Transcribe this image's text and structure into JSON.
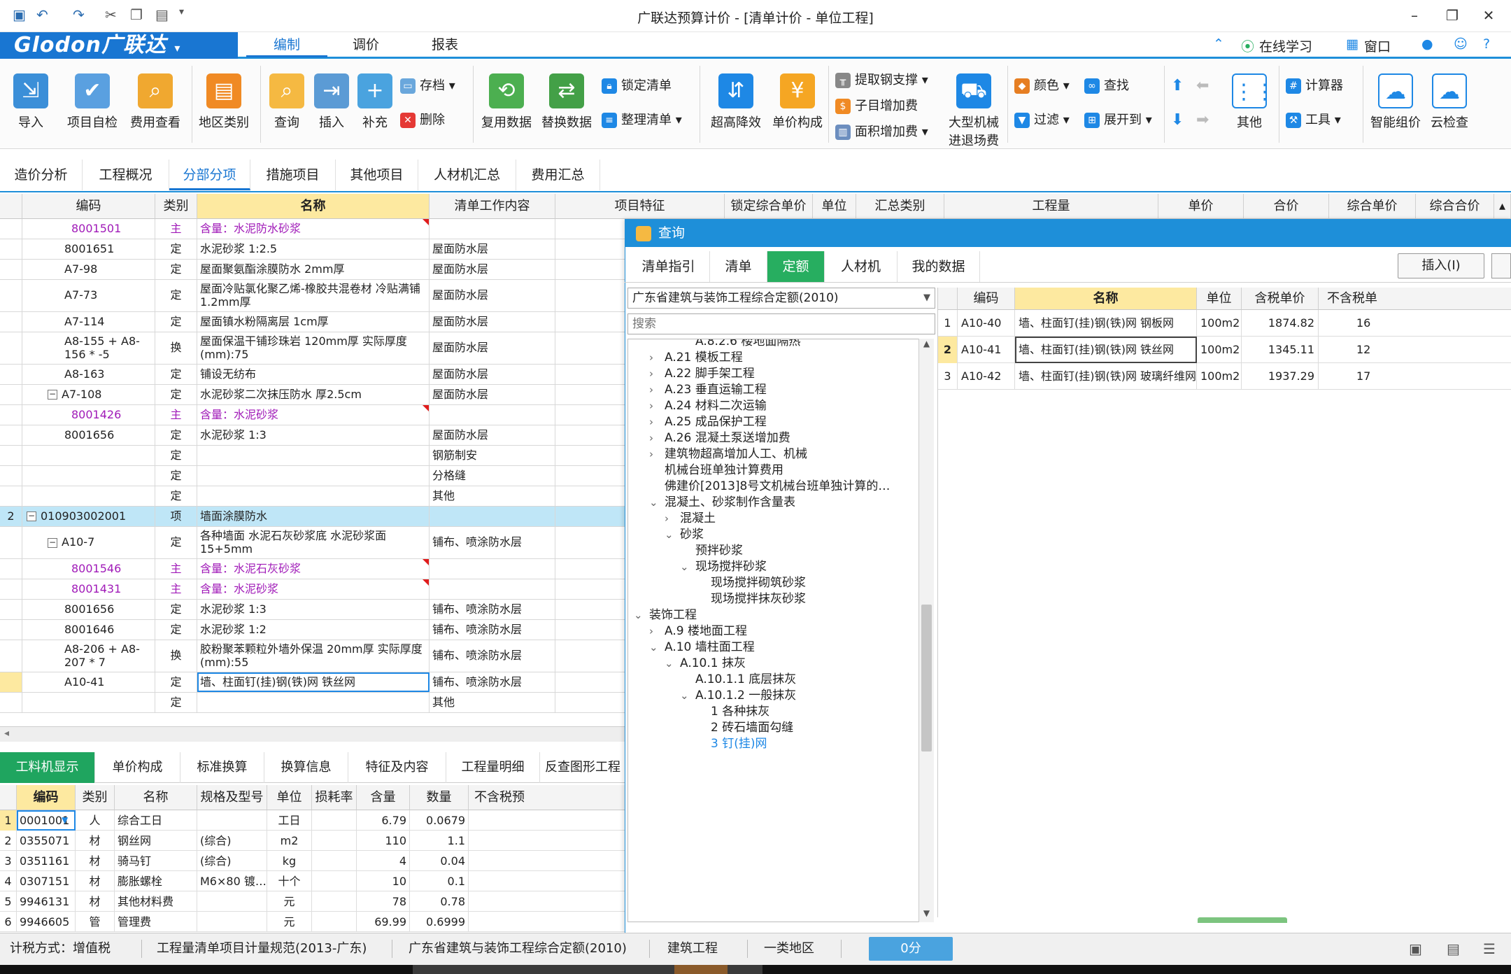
{
  "window": {
    "title": "广联达预算计价 - [清单计价 - 单位工程]"
  },
  "logo": "Glodon广联达",
  "ribbon_tabs": [
    "编制",
    "调价",
    "报表"
  ],
  "top_right": {
    "online": "在线学习",
    "window": "窗口",
    "help": "?"
  },
  "ribbon": {
    "import": "导入",
    "self_check": "项目自检",
    "fee_check": "费用查看",
    "region": "地区类别",
    "query": "查询",
    "insert": "插入",
    "supplement": "补充",
    "save": "存档",
    "delete": "删除",
    "reuse": "复用数据",
    "replace": "替换数据",
    "lock_list": "锁定清单",
    "sort_list": "整理清单",
    "over_height": "超高降效",
    "unit_price": "单价构成",
    "steel_support": "提取钢支撑",
    "sub_fee": "子目增加费",
    "area_fee": "面积增加费",
    "machinery_line1": "大型机械",
    "machinery_line2": "进退场费",
    "color": "颜色",
    "find": "查找",
    "filter": "过滤",
    "expand": "展开到",
    "other": "其他",
    "calculator": "计算器",
    "tools": "工具",
    "smart": "智能组价",
    "cloud": "云检查"
  },
  "module_tabs": [
    "造价分析",
    "工程概况",
    "分部分项",
    "措施项目",
    "其他项目",
    "人材机汇总",
    "费用汇总"
  ],
  "grid": {
    "headers": [
      "编码",
      "类别",
      "名称",
      "清单工作内容",
      "项目特征",
      "锁定综合单价",
      "单位",
      "汇总类别",
      "工程量",
      "单价",
      "合价",
      "综合单价",
      "综合合价"
    ],
    "rows": [
      {
        "num": "",
        "code": "8001501",
        "type": "主",
        "name": "含量：水泥防水砂浆",
        "content": "",
        "purple": true
      },
      {
        "num": "",
        "code": "8001651",
        "type": "定",
        "name": "水泥砂浆 1:2.5",
        "content": "屋面防水层"
      },
      {
        "num": "",
        "code": "A7-98",
        "type": "定",
        "name": "屋面聚氨酯涂膜防水 2mm厚",
        "content": "屋面防水层"
      },
      {
        "num": "",
        "code": "A7-73",
        "type": "定",
        "name": "屋面冷贴氯化聚乙烯-橡胶共混卷材 冷贴满铺 1.2mm厚",
        "content": "屋面防水层"
      },
      {
        "num": "",
        "code": "A7-114",
        "type": "定",
        "name": "屋面镇水粉隔离层 1cm厚",
        "content": "屋面防水层"
      },
      {
        "num": "",
        "code": "A8-155 + A8-156 * -5",
        "type": "换",
        "name": "屋面保温干铺珍珠岩 120mm厚  实际厚度(mm):75",
        "content": "屋面防水层"
      },
      {
        "num": "",
        "code": "A8-163",
        "type": "定",
        "name": "铺设无纺布",
        "content": "屋面防水层"
      },
      {
        "num": "",
        "code": "A7-108",
        "type": "定",
        "name": "水泥砂浆二次抹压防水 厚2.5cm",
        "content": "屋面防水层"
      },
      {
        "num": "",
        "code": "8001426",
        "type": "主",
        "name": "含量：水泥砂浆",
        "content": "",
        "purple": true
      },
      {
        "num": "",
        "code": "8001656",
        "type": "定",
        "name": "水泥砂浆 1:3",
        "content": "屋面防水层"
      },
      {
        "num": "",
        "code": "",
        "type": "定",
        "name": "",
        "content": "钢筋制安"
      },
      {
        "num": "",
        "code": "",
        "type": "定",
        "name": "",
        "content": "分格缝"
      },
      {
        "num": "",
        "code": "",
        "type": "定",
        "name": "",
        "content": "其他"
      },
      {
        "num": "2",
        "code": "010903002001",
        "type": "项",
        "name": "墙面涂膜防水",
        "content": ""
      },
      {
        "num": "",
        "code": "A10-7",
        "type": "定",
        "name": "各种墙面 水泥石灰砂浆底 水泥砂浆面 15+5mm",
        "content": "铺布、喷涂防水层"
      },
      {
        "num": "",
        "code": "8001546",
        "type": "主",
        "name": "含量：水泥石灰砂浆",
        "content": "",
        "purple": true
      },
      {
        "num": "",
        "code": "8001431",
        "type": "主",
        "name": "含量：水泥砂浆",
        "content": "",
        "purple": true
      },
      {
        "num": "",
        "code": "8001656",
        "type": "定",
        "name": "水泥砂浆 1:3",
        "content": "铺布、喷涂防水层"
      },
      {
        "num": "",
        "code": "8001646",
        "type": "定",
        "name": "水泥砂浆 1:2",
        "content": "铺布、喷涂防水层"
      },
      {
        "num": "",
        "code": "A8-206 + A8-207 * 7",
        "type": "换",
        "name": "胶粉聚苯颗粒外墙外保温 20mm厚  实际厚度(mm):55",
        "content": "铺布、喷涂防水层"
      },
      {
        "num": "",
        "code": "A10-41",
        "type": "定",
        "name": "墙、柱面钉(挂)钢(铁)网 铁丝网",
        "content": "铺布、喷涂防水层"
      },
      {
        "num": "",
        "code": "",
        "type": "定",
        "name": "",
        "content": "其他"
      }
    ]
  },
  "bottom_tabs": [
    "工料机显示",
    "单价构成",
    "标准换算",
    "换算信息",
    "特征及内容",
    "工程量明细",
    "反查图形工程"
  ],
  "bottom_grid": {
    "headers": [
      "编码",
      "类别",
      "名称",
      "规格及型号",
      "单位",
      "损耗率",
      "含量",
      "数量",
      "不含税预"
    ],
    "rows": [
      {
        "idx": "1",
        "code": "0001001",
        "type": "人",
        "name": "综合工日",
        "spec": "",
        "unit": "工日",
        "loss": "",
        "content": "6.79",
        "qty": "0.0679"
      },
      {
        "idx": "2",
        "code": "0355071",
        "type": "材",
        "name": "钢丝网",
        "spec": "(综合)",
        "unit": "m2",
        "loss": "",
        "content": "110",
        "qty": "1.1"
      },
      {
        "idx": "3",
        "code": "0351161",
        "type": "材",
        "name": "骑马钉",
        "spec": "(综合)",
        "unit": "kg",
        "loss": "",
        "content": "4",
        "qty": "0.04"
      },
      {
        "idx": "4",
        "code": "0307151",
        "type": "材",
        "name": "膨胀螺栓",
        "spec": "M6×80 镀…",
        "unit": "十个",
        "loss": "",
        "content": "10",
        "qty": "0.1"
      },
      {
        "idx": "5",
        "code": "9946131",
        "type": "材",
        "name": "其他材料费",
        "spec": "",
        "unit": "元",
        "loss": "",
        "content": "78",
        "qty": "0.78"
      },
      {
        "idx": "6",
        "code": "9946605",
        "type": "管",
        "name": "管理费",
        "spec": "",
        "unit": "元",
        "loss": "",
        "content": "69.99",
        "qty": "0.6999"
      }
    ]
  },
  "query": {
    "title": "查询",
    "tabs": [
      "清单指引",
      "清单",
      "定额",
      "人材机",
      "我的数据"
    ],
    "insert": "插入(I)",
    "library": "广东省建筑与装饰工程综合定额(2010)",
    "search_placeholder": "搜索",
    "tree": [
      {
        "label": "A.8.2.6 楼地面隔热",
        "arrow": ""
      },
      {
        "label": "A.21 模板工程",
        "arrow": "›"
      },
      {
        "label": "A.22 脚手架工程",
        "arrow": "›"
      },
      {
        "label": "A.23 垂直运输工程",
        "arrow": "›"
      },
      {
        "label": "A.24 材料二次运输",
        "arrow": "›"
      },
      {
        "label": "A.25 成品保护工程",
        "arrow": "›"
      },
      {
        "label": "A.26 混凝土泵送增加费",
        "arrow": "›"
      },
      {
        "label": "建筑物超高增加人工、机械",
        "arrow": "›"
      },
      {
        "label": "机械台班单独计算费用",
        "arrow": ""
      },
      {
        "label": "佛建价[2013]8号文机械台班单独计算的…",
        "arrow": ""
      },
      {
        "label": "混凝土、砂浆制作含量表",
        "arrow": "⌄"
      },
      {
        "label": "混凝土",
        "arrow": "›"
      },
      {
        "label": "砂浆",
        "arrow": "⌄"
      },
      {
        "label": "预拌砂浆",
        "arrow": ""
      },
      {
        "label": "现场搅拌砂浆",
        "arrow": "⌄"
      },
      {
        "label": "现场搅拌砌筑砂浆",
        "arrow": ""
      },
      {
        "label": "现场搅拌抹灰砂浆",
        "arrow": ""
      },
      {
        "label": "装饰工程",
        "arrow": "⌄"
      },
      {
        "label": "A.9 楼地面工程",
        "arrow": "›"
      },
      {
        "label": "A.10 墙柱面工程",
        "arrow": "⌄"
      },
      {
        "label": "A.10.1 抹灰",
        "arrow": "⌄"
      },
      {
        "label": "A.10.1.1 底层抹灰",
        "arrow": ""
      },
      {
        "label": "A.10.1.2 一般抹灰",
        "arrow": "⌄"
      },
      {
        "label": "1 各种抹灰",
        "arrow": ""
      },
      {
        "label": "2 砖石墙面勾缝",
        "arrow": ""
      },
      {
        "label": "3 钉(挂)网",
        "arrow": ""
      }
    ],
    "grid_headers": [
      "编码",
      "名称",
      "单位",
      "含税单价",
      "不含税单"
    ],
    "grid_rows": [
      {
        "idx": "1",
        "code": "A10-40",
        "name": "墙、柱面钉(挂)钢(铁)网 钢板网",
        "unit": "100m2",
        "price": "1874.82",
        "price2": "16"
      },
      {
        "idx": "2",
        "code": "A10-41",
        "name": "墙、柱面钉(挂)钢(铁)网 铁丝网",
        "unit": "100m2",
        "price": "1345.11",
        "price2": "12"
      },
      {
        "idx": "3",
        "code": "A10-42",
        "name": "墙、柱面钉(挂)钢(铁)网 玻璃纤维网",
        "unit": "100m2",
        "price": "1937.29",
        "price2": "17"
      }
    ]
  },
  "status": {
    "tax": "计税方式：增值税",
    "spec": "工程量清单项目计量规范(2013-广东)",
    "quota": "广东省建筑与装饰工程综合定额(2010)",
    "type": "建筑工程",
    "region": "一类地区",
    "score": "0分"
  },
  "colors": {
    "accent": "#1976d2",
    "green_tab": "#27ae60",
    "selected_row": "#bfe6f7",
    "header_highlight": "#fde9a0",
    "purple_text": "#a01ab8"
  }
}
